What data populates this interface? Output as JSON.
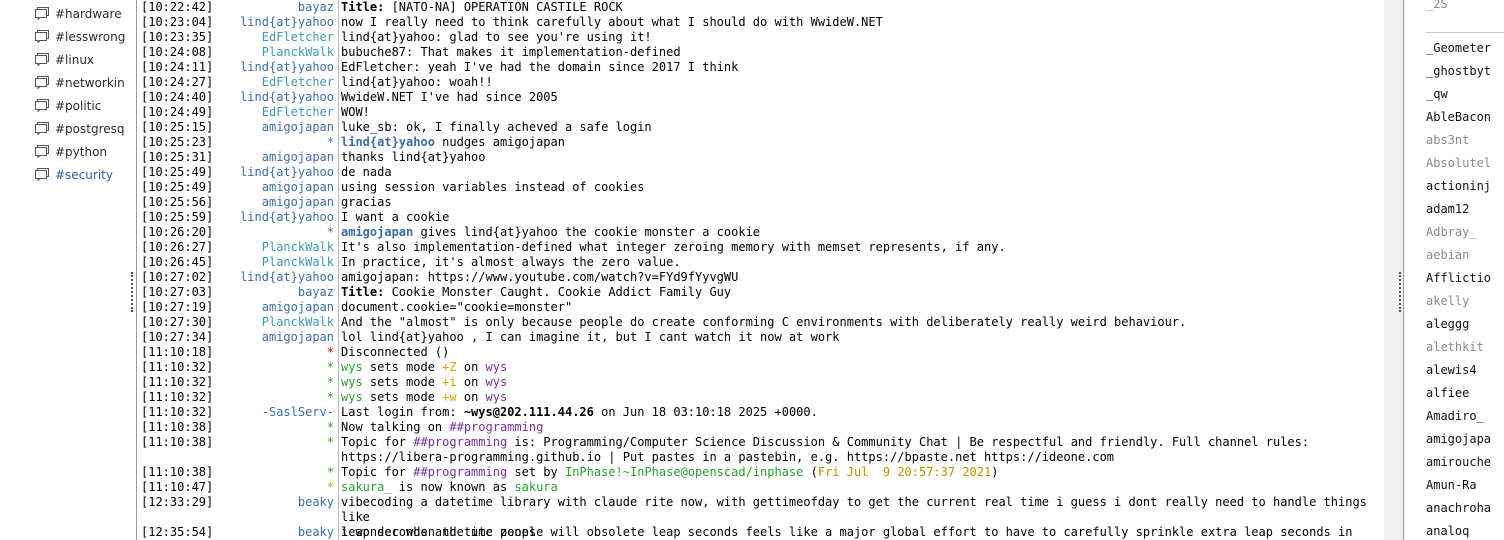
{
  "colors": {
    "timestamp": "#000000",
    "nick_blue": "#3b6ea5",
    "nick_star_red": "#cc0000",
    "nick_star_green": "#2aa02a",
    "nick_star_yellow": "#d8a000",
    "nick_sasl": "#3b6ea5",
    "green_text": "#2aa02a",
    "purple_text": "#7b2f9e",
    "yellow_text": "#c09000",
    "link_blue": "#2a5ea8",
    "active_channel": "#2a5ea8"
  },
  "channels": [
    {
      "name": "#hardware",
      "active": false
    },
    {
      "name": "#lesswrong",
      "active": false
    },
    {
      "name": "#linux",
      "active": false
    },
    {
      "name": "#networkin",
      "active": false
    },
    {
      "name": "#politic",
      "active": false
    },
    {
      "name": "#postgresq",
      "active": false
    },
    {
      "name": "#python",
      "active": false
    },
    {
      "name": "#security",
      "active": true
    }
  ],
  "messages": [
    {
      "ts": "[10:22:42]",
      "nick": "bayaz",
      "nick_color": "#3b6ea5",
      "parts": [
        {
          "t": "Title: ",
          "b": true
        },
        {
          "t": "[NATO-NA] OPERATION CASTILE ROCK"
        }
      ]
    },
    {
      "ts": "[10:23:04]",
      "nick": "lind{at}yahoo",
      "nick_color": "#3b6ea5",
      "parts": [
        {
          "t": "now I really need to think carefully about what I should do with WwideW.NET"
        }
      ]
    },
    {
      "ts": "[10:23:35]",
      "nick": "EdFletcher",
      "nick_color": "#3b9ab0",
      "parts": [
        {
          "t": "lind{at}yahoo: glad to see you're using it!"
        }
      ]
    },
    {
      "ts": "[10:24:08]",
      "nick": "PlanckWalk",
      "nick_color": "#3b9ab0",
      "parts": [
        {
          "t": "bubuche87: That makes it implementation-defined"
        }
      ]
    },
    {
      "ts": "[10:24:11]",
      "nick": "lind{at}yahoo",
      "nick_color": "#3b6ea5",
      "parts": [
        {
          "t": "EdFletcher: yeah I've had the domain since 2017 I think"
        }
      ]
    },
    {
      "ts": "[10:24:27]",
      "nick": "EdFletcher",
      "nick_color": "#3b9ab0",
      "parts": [
        {
          "t": "lind{at}yahoo: woah!!"
        }
      ]
    },
    {
      "ts": "[10:24:40]",
      "nick": "lind{at}yahoo",
      "nick_color": "#3b6ea5",
      "parts": [
        {
          "t": "WwideW.NET I've had since 2005"
        }
      ]
    },
    {
      "ts": "[10:24:49]",
      "nick": "EdFletcher",
      "nick_color": "#3b9ab0",
      "parts": [
        {
          "t": "WOW!"
        }
      ]
    },
    {
      "ts": "[10:25:15]",
      "nick": "amigojapan",
      "nick_color": "#3b6ea5",
      "parts": [
        {
          "t": "luke_sb: ok, I finally acheved a safe login"
        }
      ]
    },
    {
      "ts": "[10:25:23]",
      "nick": "*",
      "nick_color": "#3b6ea5",
      "parts": [
        {
          "t": "lind{at}yahoo",
          "b": true,
          "c": "#3b6ea5"
        },
        {
          "t": " nudges amigojapan"
        }
      ]
    },
    {
      "ts": "[10:25:31]",
      "nick": "amigojapan",
      "nick_color": "#3b6ea5",
      "parts": [
        {
          "t": "thanks lind{at}yahoo"
        }
      ]
    },
    {
      "ts": "[10:25:49]",
      "nick": "lind{at}yahoo",
      "nick_color": "#3b6ea5",
      "parts": [
        {
          "t": "de nada"
        }
      ]
    },
    {
      "ts": "[10:25:49]",
      "nick": "amigojapan",
      "nick_color": "#3b6ea5",
      "parts": [
        {
          "t": "using session variables instead of cookies"
        }
      ]
    },
    {
      "ts": "[10:25:56]",
      "nick": "amigojapan",
      "nick_color": "#3b6ea5",
      "parts": [
        {
          "t": "gracias"
        }
      ]
    },
    {
      "ts": "[10:25:59]",
      "nick": "lind{at}yahoo",
      "nick_color": "#3b6ea5",
      "parts": [
        {
          "t": "I want a cookie"
        }
      ]
    },
    {
      "ts": "[10:26:20]",
      "nick": "*",
      "nick_color": "#3b6ea5",
      "parts": [
        {
          "t": "amigojapan",
          "b": true,
          "c": "#3b6ea5"
        },
        {
          "t": " gives lind{at}yahoo the cookie monster a cookie"
        }
      ]
    },
    {
      "ts": "[10:26:27]",
      "nick": "PlanckWalk",
      "nick_color": "#3b9ab0",
      "parts": [
        {
          "t": "It's also implementation-defined what integer zeroing memory with memset represents, if any."
        }
      ]
    },
    {
      "ts": "[10:26:45]",
      "nick": "PlanckWalk",
      "nick_color": "#3b9ab0",
      "parts": [
        {
          "t": "In practice, it's almost always the zero value."
        }
      ]
    },
    {
      "ts": "[10:27:02]",
      "nick": "lind{at}yahoo",
      "nick_color": "#3b6ea5",
      "parts": [
        {
          "t": "amigojapan: https://www.youtube.com/watch?v=FYd9fYyvgWU"
        }
      ]
    },
    {
      "ts": "[10:27:03]",
      "nick": "bayaz",
      "nick_color": "#3b6ea5",
      "parts": [
        {
          "t": "Title: ",
          "b": true
        },
        {
          "t": "Cookie Monster Caught. Cookie Addict Family Guy"
        }
      ]
    },
    {
      "ts": "[10:27:19]",
      "nick": "amigojapan",
      "nick_color": "#3b6ea5",
      "parts": [
        {
          "t": "document.cookie=\"cookie=monster\""
        }
      ]
    },
    {
      "ts": "[10:27:30]",
      "nick": "PlanckWalk",
      "nick_color": "#3b9ab0",
      "parts": [
        {
          "t": "And the \"almost\" is only because people do create conforming C environments with deliberately really weird behaviour."
        }
      ]
    },
    {
      "ts": "[10:27:34]",
      "nick": "amigojapan",
      "nick_color": "#3b6ea5",
      "parts": [
        {
          "t": "lol lind{at}yahoo , I can imagine it, but I cant watch it now at work"
        }
      ]
    },
    {
      "ts": "[11:10:18]",
      "nick": "*",
      "nick_color": "#cc0000",
      "parts": [
        {
          "t": "Disconnected ()"
        }
      ]
    },
    {
      "ts": "[11:10:32]",
      "nick": "*",
      "nick_color": "#2aa02a",
      "parts": [
        {
          "t": "wys",
          "c": "#2aa02a"
        },
        {
          "t": " sets mode "
        },
        {
          "t": "+Z",
          "c": "#d8a000"
        },
        {
          "t": " on "
        },
        {
          "t": "wys",
          "c": "#7b2f9e"
        }
      ]
    },
    {
      "ts": "[11:10:32]",
      "nick": "*",
      "nick_color": "#2aa02a",
      "parts": [
        {
          "t": "wys",
          "c": "#2aa02a"
        },
        {
          "t": " sets mode "
        },
        {
          "t": "+i",
          "c": "#d8a000"
        },
        {
          "t": " on "
        },
        {
          "t": "wys",
          "c": "#7b2f9e"
        }
      ]
    },
    {
      "ts": "[11:10:32]",
      "nick": "*",
      "nick_color": "#2aa02a",
      "parts": [
        {
          "t": "wys",
          "c": "#2aa02a"
        },
        {
          "t": " sets mode "
        },
        {
          "t": "+w",
          "c": "#d8a000"
        },
        {
          "t": " on "
        },
        {
          "t": "wys",
          "c": "#7b2f9e"
        }
      ]
    },
    {
      "ts": "[11:10:32]",
      "nick": "-SaslServ-",
      "nick_color": "#3b6ea5",
      "parts": [
        {
          "t": "Last login from: "
        },
        {
          "t": "~wys@202.111.44.26",
          "b": true
        },
        {
          "t": " on Jun 18 03:10:18 2025 +0000."
        }
      ]
    },
    {
      "ts": "[11:10:38]",
      "nick": "*",
      "nick_color": "#2aa02a",
      "parts": [
        {
          "t": "Now talking on "
        },
        {
          "t": "##programming",
          "c": "#7b2f9e"
        }
      ]
    },
    {
      "ts": "[11:10:38]",
      "nick": "*",
      "nick_color": "#2aa02a",
      "parts": [
        {
          "t": "Topic for "
        },
        {
          "t": "##programming",
          "c": "#7b2f9e"
        },
        {
          "t": " is: Programming/Computer Science Discussion & Community Chat | Be respectful and friendly. Full channel rules:\nhttps://libera-programming.github.io | Put pastes in a pastebin, e.g. https://bpaste.net https://ideone.com"
        }
      ]
    },
    {
      "ts": "[11:10:38]",
      "nick": "*",
      "nick_color": "#2aa02a",
      "parts": [
        {
          "t": "Topic for "
        },
        {
          "t": "##programming",
          "c": "#7b2f9e"
        },
        {
          "t": " set by "
        },
        {
          "t": "InPhase!~InPhase@openscad/inphase",
          "c": "#2aa02a"
        },
        {
          "t": " ("
        },
        {
          "t": "Fri Jul  9 20:57:37 2021",
          "c": "#c09000"
        },
        {
          "t": ")"
        }
      ]
    },
    {
      "ts": "[11:10:47]",
      "nick": "*",
      "nick_color": "#d8a000",
      "parts": [
        {
          "t": "sakura_",
          "c": "#2aa02a"
        },
        {
          "t": " is now known as "
        },
        {
          "t": "sakura",
          "c": "#2aa02a"
        }
      ]
    },
    {
      "ts": "[12:33:29]",
      "nick": "beaky",
      "nick_color": "#3b6ea5",
      "parts": [
        {
          "t": "vibecoding a datetime library with claude rite now, with gettimeofday to get the current real time i guess i dont really need to handle things like\nleap seconds and time zones"
        }
      ]
    },
    {
      "ts": "[12:35:54]",
      "nick": "beaky",
      "nick_color": "#3b6ea5",
      "parts": [
        {
          "t": "i wonder when the utc people will obsolete leap seconds feels like a major global effort to have to carefully sprinkle extra leap seconds in"
        }
      ]
    }
  ],
  "users": [
    {
      "name": "_2S",
      "away": true
    },
    {
      "name": "_Geometer",
      "away": false
    },
    {
      "name": "_ghostbyt",
      "away": false
    },
    {
      "name": "_qw",
      "away": false
    },
    {
      "name": "AbleBacon",
      "away": false
    },
    {
      "name": "abs3nt",
      "away": true
    },
    {
      "name": "Absolutel",
      "away": true
    },
    {
      "name": "actioninj",
      "away": false
    },
    {
      "name": "adam12",
      "away": false
    },
    {
      "name": "Adbray_",
      "away": true
    },
    {
      "name": "aebian",
      "away": true
    },
    {
      "name": "Afflictio",
      "away": false
    },
    {
      "name": "akelly",
      "away": true
    },
    {
      "name": "aleggg",
      "away": false
    },
    {
      "name": "alethkit",
      "away": true
    },
    {
      "name": "alewis4",
      "away": false
    },
    {
      "name": "alfiee",
      "away": false
    },
    {
      "name": "Amadiro_",
      "away": false
    },
    {
      "name": "amigojapa",
      "away": false
    },
    {
      "name": "amirouche",
      "away": false
    },
    {
      "name": "Amun-Ra",
      "away": false
    },
    {
      "name": "anachroha",
      "away": false
    },
    {
      "name": "analoq",
      "away": false
    }
  ]
}
